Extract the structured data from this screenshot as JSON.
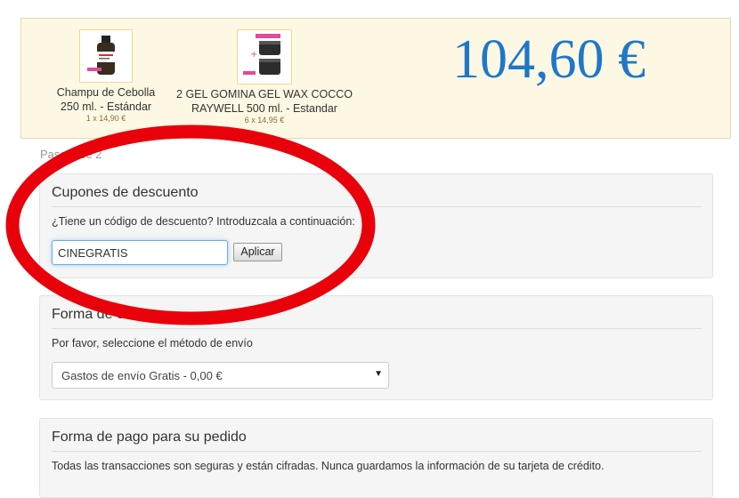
{
  "cart": {
    "products": [
      {
        "name_line1": "Champu de Cebolla",
        "name_line2": "250 ml. - Estándar",
        "price": "1 x 14,90 €",
        "thumb_icon": "shampoo-bottle-icon"
      },
      {
        "name_line1": "2 GEL GOMINA GEL WAX COCCO",
        "name_line2": "RAYWELL 500 ml. - Estandar",
        "price": "6 x 14,95 €",
        "thumb_icon": "gel-jars-icon"
      }
    ],
    "total": "104,60 €",
    "total_color": "#1e78c8"
  },
  "step": {
    "label": "Paso 2 de 2"
  },
  "coupon": {
    "title": "Cupones de descuento",
    "prompt": "¿Tiene un código de descuento? Introduzcala a continuación:",
    "input_value": "CINEGRATIS",
    "apply_label": "Aplicar"
  },
  "shipping": {
    "title": "Forma de envío",
    "prompt": "Por favor, seleccione el método de envío",
    "selected_option": "Gastos de envío Gratis - 0,00 €"
  },
  "payment": {
    "title": "Forma de pago para su pedido",
    "note": "Todas las transacciones son seguras y están cifradas. Nunca guardamos la información de su tarjeta de crédito."
  },
  "colors": {
    "summary_bg": "#fcf8e3",
    "annotation_ring": "#e8000b"
  }
}
